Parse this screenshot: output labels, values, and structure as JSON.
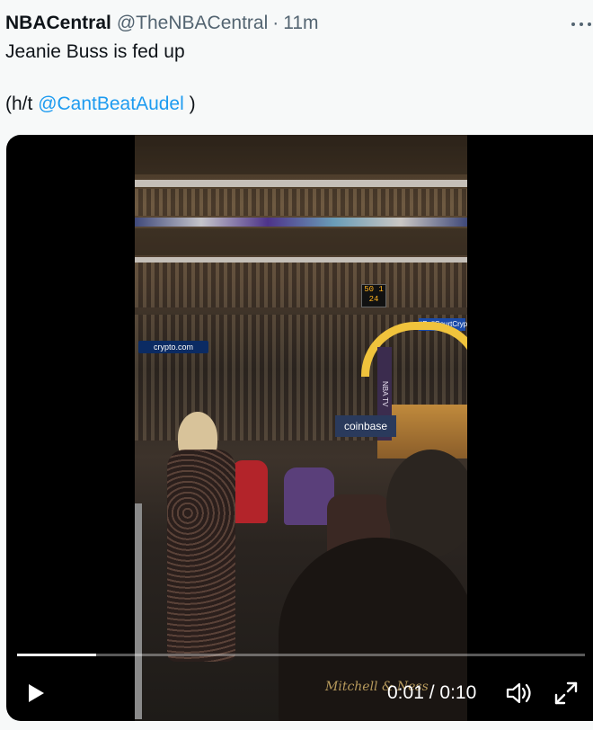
{
  "tweet": {
    "display_name": "NBACentral",
    "handle": "@TheNBACentral",
    "separator": "·",
    "timestamp": "11m",
    "text": "Jeanie Buss is fed up",
    "hat_tip_prefix": "(h/t ",
    "hat_tip_mention": "@CantBeatAudel",
    "hat_tip_suffix": " )",
    "more_icon": "more-dots-icon",
    "mention_color": "#1d9bf0"
  },
  "video": {
    "current_time": "0:01",
    "time_separator": " / ",
    "duration": "0:10",
    "progress_fraction": 0.14,
    "play_icon": "play-icon",
    "volume_icon": "volume-icon",
    "fullscreen_icon": "fullscreen-icon",
    "scene_signs": {
      "crypto": "crypto.com",
      "court": "#BallCourtCrypto",
      "coinbase": "coinbase",
      "stanchion": "NBA TV",
      "scoreboard_top": "50 1",
      "scoreboard_bottom": "24",
      "apparel_logo": "Mitchell & Ness"
    }
  }
}
